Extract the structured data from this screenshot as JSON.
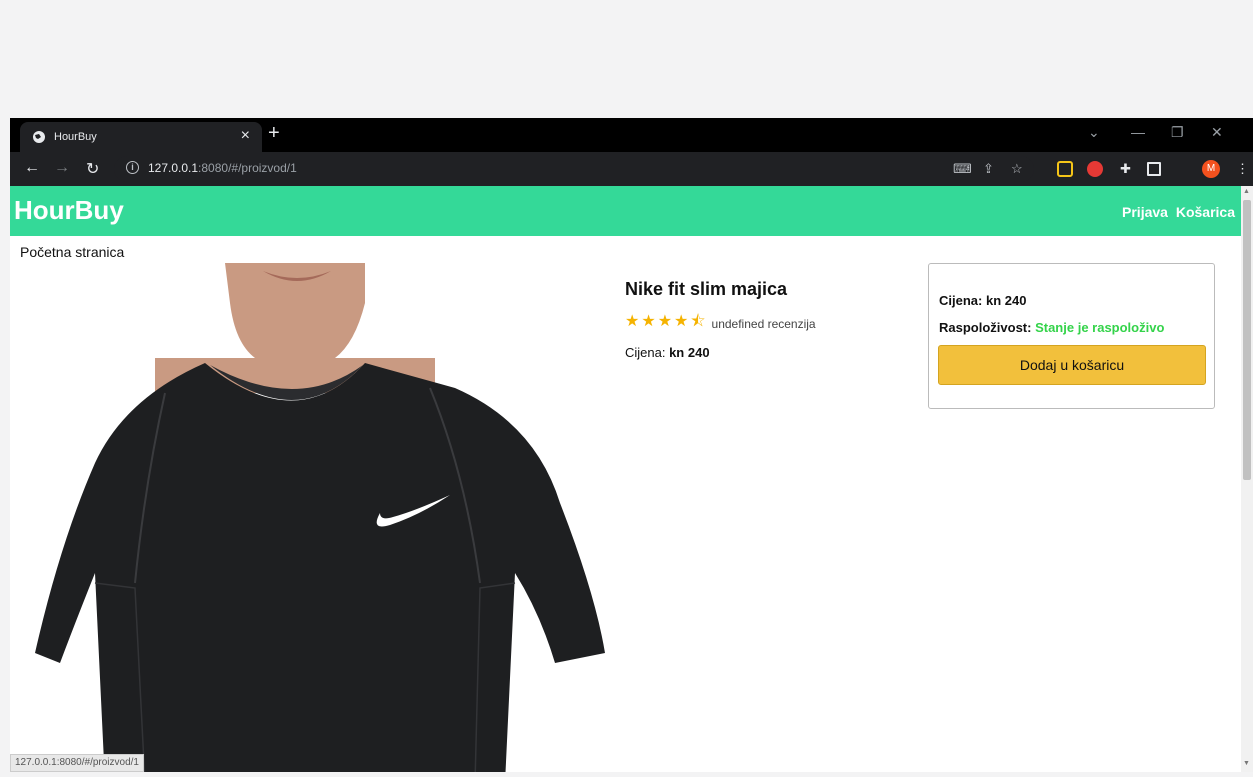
{
  "browser": {
    "tab_title": "HourBuy",
    "url_host": "127.0.0.1",
    "url_rest": ":8080/#/proizvod/1",
    "status_url": "127.0.0.1:8080/#/proizvod/1",
    "avatar_letter": "M"
  },
  "header": {
    "brand": "HourBuy",
    "login_link": "Prijava",
    "cart_link": "Košarica",
    "accent_color": "#34d998"
  },
  "breadcrumb": "Početna stranica",
  "product": {
    "title": "Nike fit slim majica",
    "rating_stars": 4.5,
    "reviews_text": "undefined recenzija",
    "price_label": "Cijena: ",
    "price_value": "kn 240"
  },
  "buybox": {
    "price_label": "Cijena: ",
    "price_value": "kn 240",
    "availability_label": "Raspoloživost: ",
    "availability_value": "Stanje je raspoloživo",
    "add_button": "Dodaj u košaricu",
    "button_color": "#f2c03c"
  }
}
